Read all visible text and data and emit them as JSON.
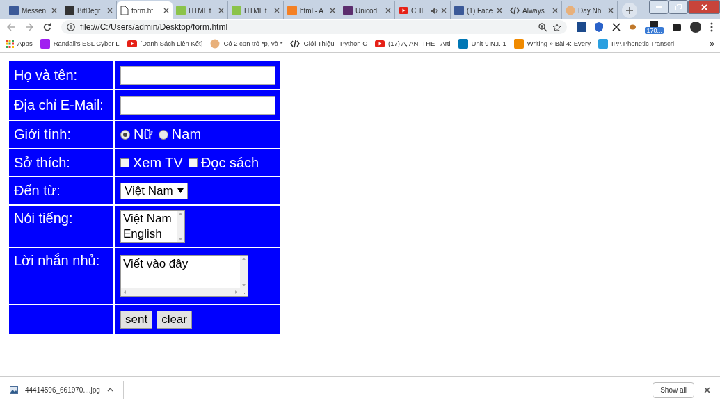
{
  "browser": {
    "tabs": [
      {
        "title": "Messen",
        "kind": "facebook",
        "selected": false
      },
      {
        "title": "BitDegr",
        "kind": "shield",
        "selected": false
      },
      {
        "title": "form.ht",
        "kind": "page",
        "selected": true
      },
      {
        "title": "HTML t",
        "kind": "w3",
        "selected": false
      },
      {
        "title": "HTML t",
        "kind": "w3",
        "selected": false
      },
      {
        "title": "html - A",
        "kind": "stack",
        "selected": false
      },
      {
        "title": "Unicod",
        "kind": "ut",
        "selected": false
      },
      {
        "title": "CHI",
        "kind": "youtube",
        "selected": false,
        "audio": true
      },
      {
        "title": "(1) Face",
        "kind": "facebook",
        "selected": false
      },
      {
        "title": "Always",
        "kind": "arrows",
        "selected": false
      },
      {
        "title": "Day Nh",
        "kind": "avatar",
        "selected": false
      }
    ],
    "address": "file:///C:/Users/admin/Desktop/form.html",
    "extension_badge": "170...",
    "bookmarks": [
      {
        "label": "Apps",
        "kind": "apps"
      },
      {
        "label": "Randall's ESL Cyber L",
        "kind": "esl"
      },
      {
        "label": "[Danh Sách Liên Kết]",
        "kind": "youtube"
      },
      {
        "label": "Có 2 con trỏ *p, và *",
        "kind": "avatar"
      },
      {
        "label": "Giới Thiệu - Python C",
        "kind": "code"
      },
      {
        "label": "(17) A, AN, THE - Arti",
        "kind": "youtube"
      },
      {
        "label": "Unit 9 N.I. 1",
        "kind": "linkedin"
      },
      {
        "label": "Writing » Bài 4: Every",
        "kind": "orange"
      },
      {
        "label": "IPA Phonetic Transcri",
        "kind": "ipa"
      }
    ],
    "bookmarks_more": "»"
  },
  "form": {
    "rows": [
      {
        "kind": "text",
        "label": "Họ và tên:"
      },
      {
        "kind": "text",
        "label": "Địa chỉ E-Mail:"
      },
      {
        "kind": "radio",
        "label": "Giới tính:",
        "options": [
          {
            "label": "Nữ",
            "selected": true
          },
          {
            "label": "Nam",
            "selected": false
          }
        ]
      },
      {
        "kind": "checkbox",
        "label": "Sở thích:",
        "options": [
          {
            "label": "Xem TV",
            "checked": false
          },
          {
            "label": "Đọc sách",
            "checked": false
          }
        ]
      },
      {
        "kind": "select",
        "label": "Đến từ:",
        "value": "Việt Nam"
      },
      {
        "kind": "listbox",
        "label": "Nói tiếng:",
        "options": [
          "Việt Nam",
          "English"
        ]
      },
      {
        "kind": "textarea",
        "label": "Lời nhắn nhủ:",
        "value": "Viết vào đây"
      },
      {
        "kind": "buttons",
        "buttons": [
          "sent",
          "clear"
        ]
      }
    ]
  },
  "downloads": {
    "file": "44414596_661970....jpg",
    "show_all": "Show all"
  }
}
